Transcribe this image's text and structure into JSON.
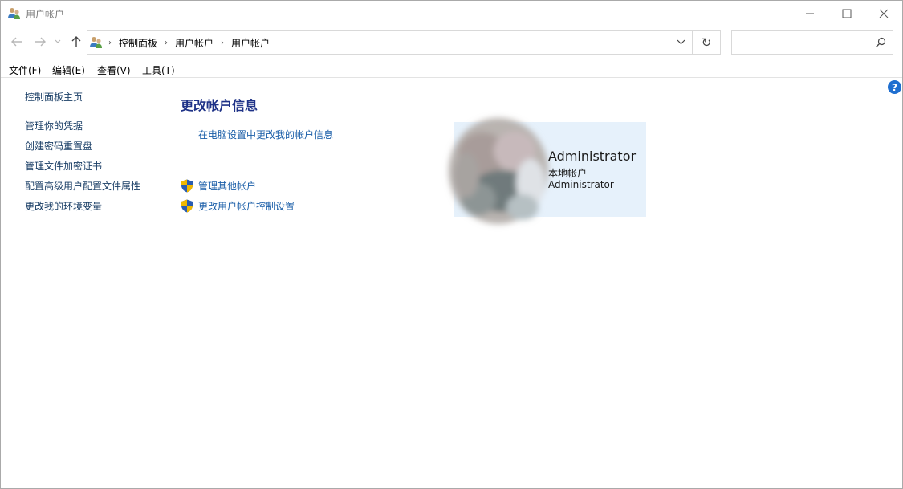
{
  "window": {
    "title": "用户帐户"
  },
  "address": {
    "crumbs": [
      "控制面板",
      "用户帐户",
      "用户帐户"
    ],
    "search_placeholder": ""
  },
  "menu": {
    "items": [
      "文件(F)",
      "编辑(E)",
      "查看(V)",
      "工具(T)"
    ]
  },
  "sidebar": {
    "links": [
      "控制面板主页",
      "管理你的凭据",
      "创建密码重置盘",
      "管理文件加密证书",
      "配置高级用户配置文件属性",
      "更改我的环境变量"
    ]
  },
  "main": {
    "title": "更改帐户信息",
    "link_pc_settings": "在电脑设置中更改我的帐户信息",
    "link_manage_other": "管理其他帐户",
    "link_uac": "更改用户帐户控制设置"
  },
  "account": {
    "name": "Administrator",
    "type": "本地帐户",
    "group": "Administrator"
  },
  "colors": {
    "link": "#1a5ea8",
    "title": "#1e3287",
    "card": "#e6f1fb"
  },
  "icons": {
    "help": "?"
  }
}
